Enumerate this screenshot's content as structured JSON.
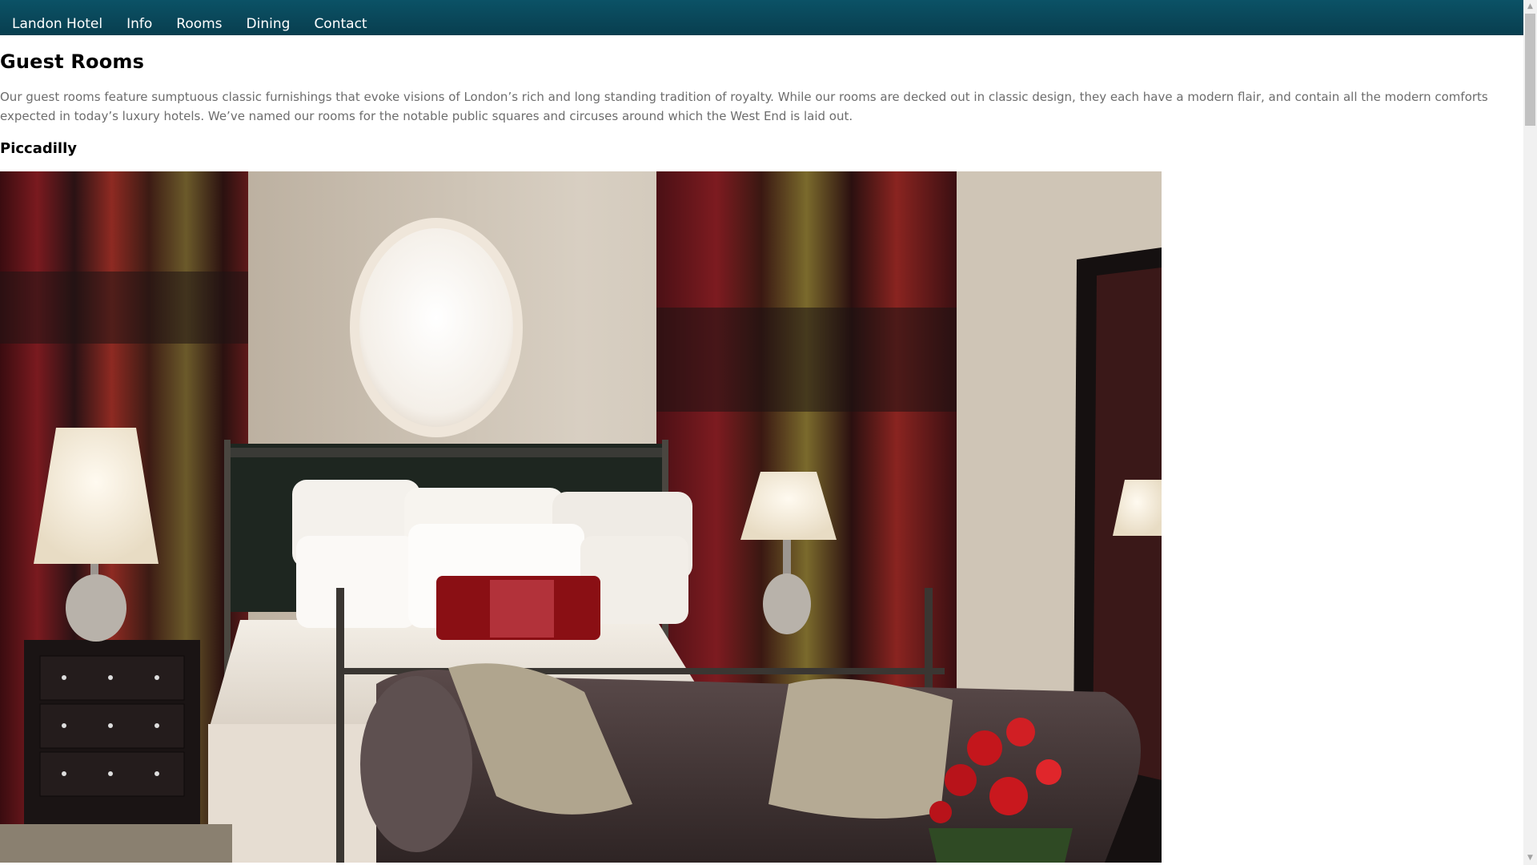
{
  "nav": {
    "items": [
      {
        "label": "Landon Hotel"
      },
      {
        "label": "Info"
      },
      {
        "label": "Rooms"
      },
      {
        "label": "Dining"
      },
      {
        "label": "Contact"
      }
    ]
  },
  "main": {
    "title": "Guest Rooms",
    "intro": "Our guest rooms feature sumptuous classic furnishings that evoke visions of London’s rich and long standing tradition of royalty. While our rooms are decked out in classic design, they each have a modern flair, and contain all the modern comforts expected in today’s luxury hotels. We’ve named our rooms for the notable public squares and circuses around which the West End is laid out.",
    "room": {
      "name": "Piccadilly",
      "image_icon": "hotel-room-photo"
    }
  },
  "colors": {
    "nav_bg": "#0b5266",
    "body_text": "#6d6d6d",
    "heading": "#000000"
  }
}
